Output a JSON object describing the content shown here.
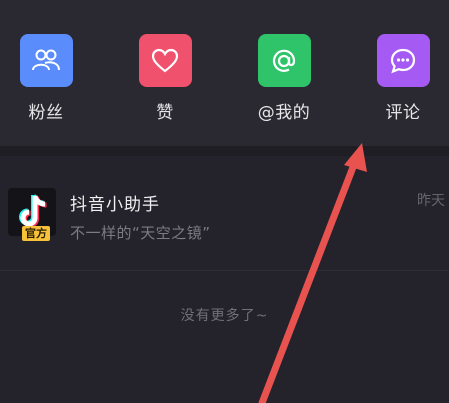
{
  "actions": [
    {
      "label": "粉丝",
      "color": "#5a8dfb",
      "icon": "fans-icon"
    },
    {
      "label": "赞",
      "color": "#f0526d",
      "icon": "heart-icon"
    },
    {
      "label": "@我的",
      "color": "#2fc46a",
      "icon": "at-icon"
    },
    {
      "label": "评论",
      "color": "#a55bf3",
      "icon": "comment-icon"
    }
  ],
  "message": {
    "title": "抖音小助手",
    "subtitle": "不一样的“天空之镜”",
    "time": "昨天",
    "badge": "官方"
  },
  "footer": "没有更多了~",
  "annotation": {
    "color": "#e9534f",
    "icon": "red-arrow-annotation"
  }
}
